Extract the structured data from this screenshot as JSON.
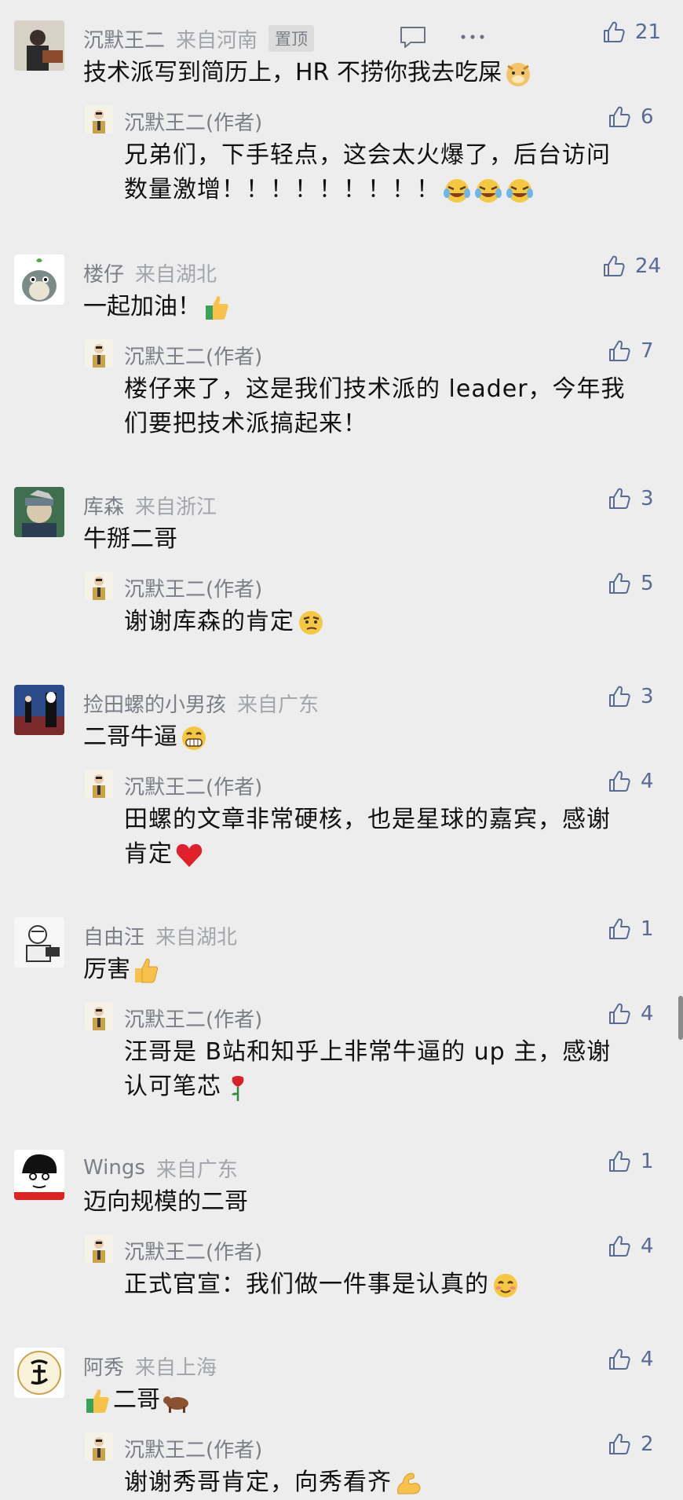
{
  "comments": [
    {
      "name": "沉默王二",
      "location": "来自河南",
      "pinned_label": "置顶",
      "text": "技术派写到简历上，HR 不捞你我去吃屎",
      "likes": "21",
      "reply": {
        "name": "沉默王二(作者)",
        "text_line1": "兄弟们，下手轻点，这会太火爆了，后台访问",
        "text_line2": "数量激增！！！！！！！！！",
        "likes": "6"
      }
    },
    {
      "name": "楼仔",
      "location": "来自湖北",
      "text": "一起加油！",
      "likes": "24",
      "reply": {
        "name": "沉默王二(作者)",
        "text_line1": "楼仔来了，这是我们技术派的 leader，今年我",
        "text_line2": "们要把技术派搞起来！",
        "likes": "7"
      }
    },
    {
      "name": "库森",
      "location": "来自浙江",
      "text": "牛掰二哥",
      "likes": "3",
      "reply": {
        "name": "沉默王二(作者)",
        "text_line1": "谢谢库森的肯定",
        "text_line2": "",
        "likes": "5"
      }
    },
    {
      "name": "捡田螺的小男孩",
      "location": "来自广东",
      "text": "二哥牛逼",
      "likes": "3",
      "reply": {
        "name": "沉默王二(作者)",
        "text_line1": "田螺的文章非常硬核，也是星球的嘉宾，感谢",
        "text_line2": "肯定",
        "likes": "4"
      }
    },
    {
      "name": "自由汪",
      "location": "来自湖北",
      "text": "厉害",
      "likes": "1",
      "reply": {
        "name": "沉默王二(作者)",
        "text_line1": "汪哥是 B站和知乎上非常牛逼的 up 主，感谢",
        "text_line2": "认可笔芯",
        "likes": "4"
      }
    },
    {
      "name": "Wings",
      "location": "来自广东",
      "text": "迈向规模的二哥",
      "likes": "1",
      "reply": {
        "name": "沉默王二(作者)",
        "text_line1": "正式官宣：我们做一件事是认真的",
        "text_line2": "",
        "likes": "4"
      }
    },
    {
      "name": "阿秀",
      "location": "来自上海",
      "text": "二哥",
      "likes": "4",
      "reply": {
        "name": "沉默王二(作者)",
        "text_line1": "谢谢秀哥肯定，向秀看齐",
        "text_line2": "",
        "likes": "2"
      }
    }
  ],
  "colors": {
    "background": "#ededed",
    "nickname": "#7b7f86",
    "location": "#a2a6ab",
    "like_accent": "#576b95",
    "text": "#111111"
  },
  "icons": [
    "comment-icon",
    "more-icon",
    "thumb-up-icon",
    "emoji"
  ]
}
